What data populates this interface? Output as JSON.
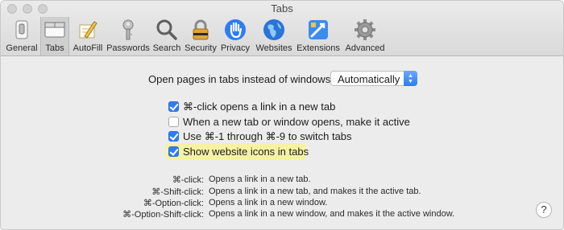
{
  "window": {
    "title": "Tabs"
  },
  "toolbar": {
    "items": [
      {
        "label": "General",
        "icon": "general-switch-icon"
      },
      {
        "label": "Tabs",
        "icon": "tabs-icon",
        "active": true
      },
      {
        "label": "AutoFill",
        "icon": "autofill-pencil-icon"
      },
      {
        "label": "Passwords",
        "icon": "key-icon"
      },
      {
        "label": "Search",
        "icon": "magnifier-icon"
      },
      {
        "label": "Security",
        "icon": "padlock-icon"
      },
      {
        "label": "Privacy",
        "icon": "hand-icon"
      },
      {
        "label": "Websites",
        "icon": "globe-icon"
      },
      {
        "label": "Extensions",
        "icon": "puzzle-icon"
      },
      {
        "label": "Advanced",
        "icon": "gear-icon"
      }
    ]
  },
  "open_pages": {
    "label": "Open pages in tabs instead of windows:",
    "selected": "Automatically"
  },
  "checkboxes": [
    {
      "label": "⌘-click opens a link in a new tab",
      "checked": true
    },
    {
      "label": "When a new tab or window opens, make it active",
      "checked": false
    },
    {
      "label": "Use ⌘-1 through ⌘-9 to switch tabs",
      "checked": true
    },
    {
      "label": "Show website icons in tabs",
      "checked": true
    }
  ],
  "help_rows": [
    {
      "key": "⌘-click:",
      "desc": "Opens a link in a new tab."
    },
    {
      "key": "⌘-Shift-click:",
      "desc": "Opens a link in a new tab, and makes it the active tab."
    },
    {
      "key": "⌘-Option-click:",
      "desc": "Opens a link in a new window."
    },
    {
      "key": "⌘-Option-Shift-click:",
      "desc": "Opens a link in a new window, and makes it the active window."
    }
  ],
  "help_button": "?",
  "colors": {
    "accent": "#2f7cf6",
    "highlight": "#f6f2a3"
  }
}
